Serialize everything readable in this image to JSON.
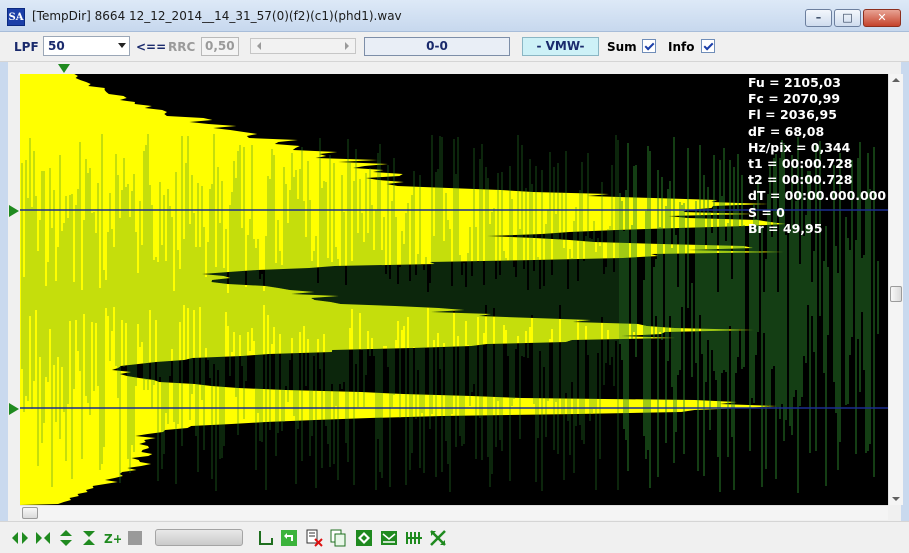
{
  "window": {
    "title": "[TempDir] 8664 12_12_2014__14_31_57(0)(f2)(c1)(phd1).wav",
    "icon_text": "SA",
    "controls": [
      "minimize-icon",
      "maximize-icon",
      "close-icon"
    ]
  },
  "toolbar": {
    "lpf_label": "LPF",
    "lpf_value": "50",
    "arrow_label": "<==",
    "rrc_label": "RRC",
    "rrc_value": "0,50",
    "range_display": "0-0",
    "mode_display": "- VMW-",
    "sum_label": "Sum",
    "sum_checked": true,
    "info_label": "Info",
    "info_checked": true
  },
  "info": {
    "lines": [
      "Fu = 2105,03",
      "Fc = 2070,99",
      "Fl = 2036,95",
      "dF = 68,08",
      "Hz/pix = 0,344",
      "t1 = 00:00.728",
      "t2 = 00:00.728",
      "dT = 00:00.000.000",
      "S = 0",
      "Br = 49,95"
    ]
  },
  "colors": {
    "plot_background": "#000000",
    "sum_fill": "#ffff00",
    "waveform": "#2e8a2e",
    "marker": "#1f8a1f",
    "cursor_line": "#1b2d8f"
  },
  "bottom_toolbar": {
    "icons": [
      "zoom-horizontal-icon",
      "fit-horizontal-icon",
      "zoom-vertical-icon",
      "fit-vertical-icon",
      "zoom-plus-icon",
      "stop-icon",
      "playback-progress",
      "marker-icon",
      "undo-icon",
      "delete-file-icon",
      "copy-icon",
      "diamond-icon",
      "envelope-icon",
      "comb-filter-icon",
      "split-icon"
    ]
  }
}
